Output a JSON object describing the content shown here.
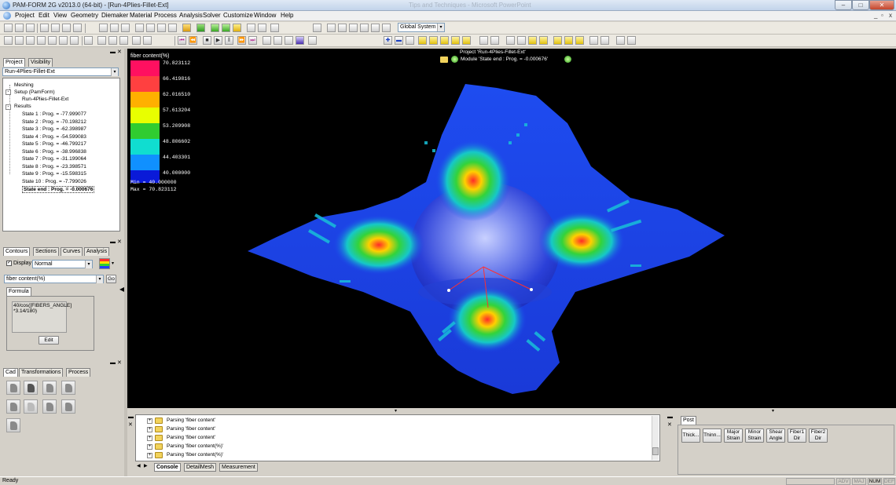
{
  "window": {
    "title": "PAM-FORM 2G v2013.0 (64-bit) - [Run-4Plies-Fillet-Ext]",
    "ghost_title": "Tips and Techniques - Microsoft PowerPoint",
    "min": "–",
    "max": "□",
    "close": "✕"
  },
  "menu": {
    "items": [
      "Project",
      "Edit",
      "View",
      "Geometry",
      "Diemaker",
      "Material",
      "Process",
      "Analysis",
      "Solver",
      "Customize",
      "Window",
      "Help"
    ],
    "mdi_min": "_",
    "mdi_restore": "▫",
    "mdi_close": "x"
  },
  "toolbar": {
    "system_combo": "Global System",
    "combo_arrow": "▾"
  },
  "project_panel": {
    "tabs": [
      "Project",
      "Visibility"
    ],
    "run_combo": "Run-4Plies-Fillet-Ext",
    "tree": {
      "meshing": "Meshing",
      "setup": "Setup (PamForm)",
      "setup_child": "Run-4Plies-Fillet-Ext",
      "results": "Results",
      "states": [
        "State 1 : Prog. = -77.999077",
        "State 2 : Prog. = -70.198212",
        "State 3 : Prog. = -62.398987",
        "State 4 : Prog. = -54.599083",
        "State 5 : Prog. = -46.799217",
        "State 6 : Prog. = -38.996838",
        "State 7 : Prog. = -31.199064",
        "State 8 : Prog. = -23.398571",
        "State 9 : Prog. = -15.598315",
        "State 10 : Prog. = -7.799026",
        "State end : Prog. = -0.000676"
      ],
      "expanders": [
        "-",
        "+",
        "-"
      ]
    }
  },
  "contours_panel": {
    "tabs": [
      "Contours",
      "Sections",
      "Curves",
      "Analysis"
    ],
    "display_label": "Display",
    "display_mode": "Normal",
    "variable": "fiber content(%)",
    "go": "Go",
    "formula_tab": "Formula",
    "formula": "40/cos([FIBERS_ANGLE]\n*3.14/180)",
    "edit": "Edit"
  },
  "cad_panel": {
    "tabs": [
      "Cad",
      "Transformations",
      "Process"
    ]
  },
  "viewport": {
    "project_line": "Project 'Run-4Plies-Fillet-Ext'",
    "module_line": "Module 'State end : Prog. = -0.000676'",
    "legend_title": "fiber content(%)",
    "legend_values": [
      "70.823112",
      "66.419816",
      "62.016510",
      "57.613204",
      "53.209908",
      "48.806602",
      "44.403301",
      "40.000000"
    ],
    "legend_colors": [
      "#ff1060",
      "#ff4040",
      "#ffb000",
      "#ffff00",
      "#3cd23c",
      "#00e0d0",
      "#0090ff",
      "#0000d8"
    ],
    "min_label": "Min = 40.000000",
    "max_label": "Max = 70.823112",
    "mesh_base": "#1c46ee",
    "dome_highlight": "#a8b4ff"
  },
  "console": {
    "lines": [
      "Parsing 'fiber content'",
      "Parsing 'fiber content'",
      "Parsing 'fiber content'",
      "Parsing 'fiber content(%)'",
      "Parsing 'fiber content(%)'"
    ],
    "tabs": [
      "Console",
      "DetailMesh",
      "Measurement"
    ]
  },
  "post": {
    "tab": "Post",
    "buttons": [
      [
        "Thick..."
      ],
      [
        "Thinn..."
      ],
      [
        "Major",
        "Strain"
      ],
      [
        "Minor",
        "Strain"
      ],
      [
        "Shear",
        "Angle"
      ],
      [
        "Fiber1",
        "Dir"
      ],
      [
        "Fiber2",
        "Dir"
      ]
    ]
  },
  "status": {
    "ready": "Ready",
    "indicators": [
      "ADV",
      "MAJ",
      "NUM",
      "DEF"
    ]
  }
}
